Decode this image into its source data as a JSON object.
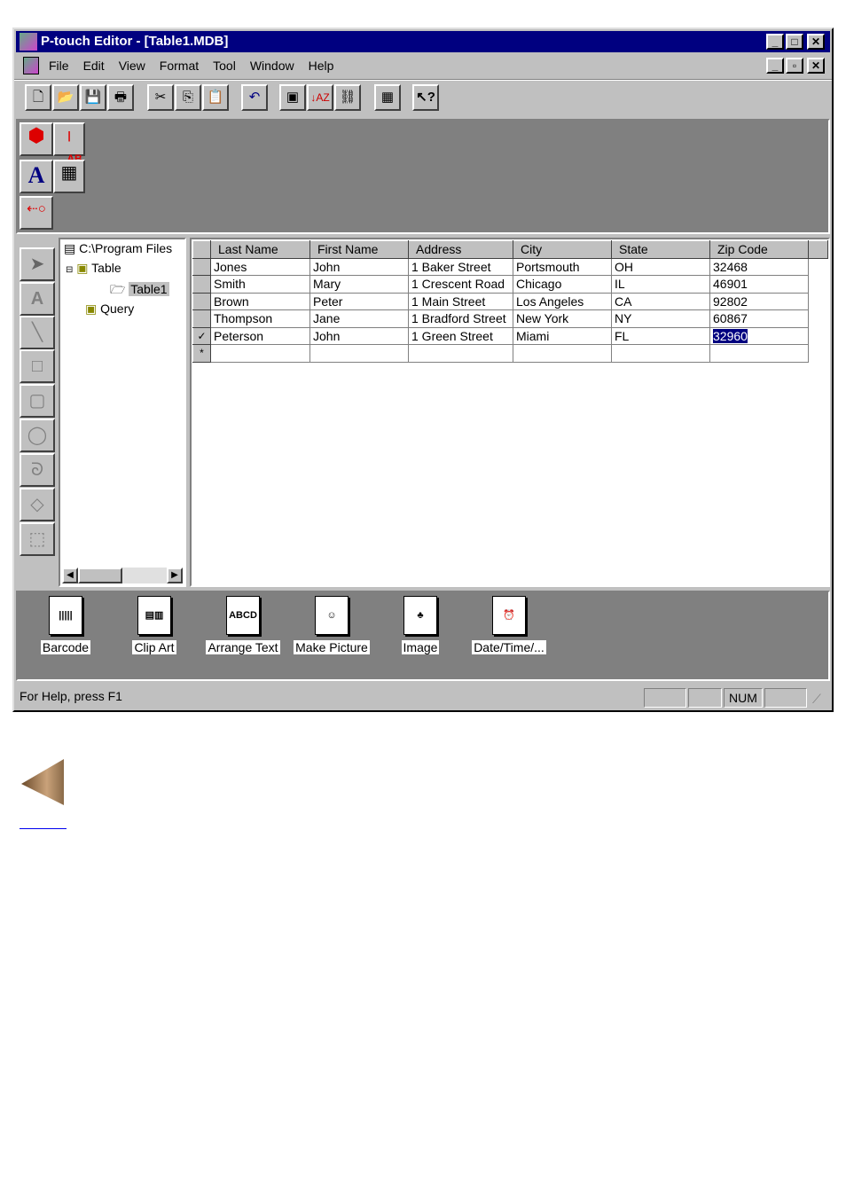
{
  "window": {
    "title": "P-touch Editor - [Table1.MDB]",
    "minimize": "_",
    "maximize": "□",
    "close": "✕",
    "restore": "🗗"
  },
  "menu": [
    "File",
    "Edit",
    "View",
    "Format",
    "Tool",
    "Window",
    "Help"
  ],
  "toolbar": [
    "new-icon",
    "open-icon",
    "save-icon",
    "print-icon",
    "cut-icon",
    "copy-icon",
    "paste-icon",
    "undo-icon",
    "form-icon",
    "sort-icon",
    "link-icon",
    "database-icon",
    "help-pointer-icon"
  ],
  "tree": {
    "root": "C:\\Program Files",
    "table": "Table",
    "table1": "Table1",
    "query": "Query"
  },
  "grid": {
    "columns": [
      "Last Name",
      "First Name",
      "Address",
      "City",
      "State",
      "Zip Code"
    ],
    "rows": [
      [
        "Jones",
        "John",
        "1 Baker Street",
        "Portsmouth",
        "OH",
        "32468"
      ],
      [
        "Smith",
        "Mary",
        "1 Crescent Road",
        "Chicago",
        "IL",
        "46901"
      ],
      [
        "Brown",
        "Peter",
        "1 Main Street",
        "Los Angeles",
        "CA",
        "92802"
      ],
      [
        "Thompson",
        "Jane",
        "1 Bradford Street",
        "New York",
        "NY",
        "60867"
      ],
      [
        "Peterson",
        "John",
        "1 Green Street",
        "Miami",
        "FL",
        "32960"
      ]
    ],
    "current_row_marker": "✓",
    "new_row_marker": "*"
  },
  "objects": [
    "Barcode",
    "Clip Art",
    "Arrange Text",
    "Make Picture",
    "Image",
    "Date/Time/..."
  ],
  "status": {
    "text": "For Help, press F1",
    "num": "NUM"
  },
  "colors": {
    "titlebar": "#000080",
    "face": "#c0c0c0",
    "workspace": "#808080",
    "selection": "#000080"
  }
}
